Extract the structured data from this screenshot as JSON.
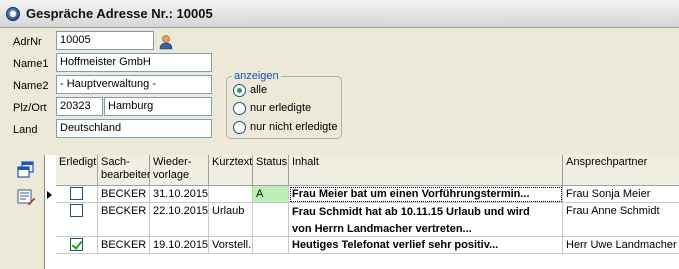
{
  "window": {
    "title": "Gespräche Adresse Nr.: 10005"
  },
  "form": {
    "adrnr_label": "AdrNr",
    "adrnr_value": "10005",
    "name1_label": "Name1",
    "name1_value": "Hoffmeister GmbH",
    "name2_label": "Name2",
    "name2_value": "- Hauptverwaltung -",
    "plzort_label": "Plz/Ort",
    "plz_value": "20323",
    "ort_value": "Hamburg",
    "land_label": "Land",
    "land_value": "Deutschland"
  },
  "filter": {
    "title": "anzeigen",
    "options": [
      "alle",
      "nur erledigte",
      "nur nicht erledigte"
    ],
    "selected": "alle"
  },
  "grid": {
    "columns": {
      "erledigt": "Erledigt",
      "sachbearbeiter_1": "Sach-",
      "sachbearbeiter_2": "bearbeiter",
      "wiedervorlage_1": "Wieder-",
      "wiedervorlage_2": "vorlage",
      "kurztext": "Kurztext",
      "status": "Status",
      "inhalt": "Inhalt",
      "ansprechpartner": "Ansprechpartner"
    },
    "rows": [
      {
        "erledigt": false,
        "sachbearbeiter": "BECKER",
        "wiedervorlage": "31.10.2015",
        "kurztext": "",
        "status": "A",
        "inhalt": "Frau Meier bat um einen Vorführungstermin...",
        "ansprechpartner": "Frau Sonja Meier"
      },
      {
        "erledigt": false,
        "sachbearbeiter": "BECKER",
        "wiedervorlage": "22.10.2015",
        "kurztext": "Urlaub",
        "status": "",
        "inhalt": "Frau Schmidt hat ab 10.11.15 Urlaub und wird",
        "inhalt_line2": "von Herrn Landmacher vertreten...",
        "ansprechpartner": "Frau Anne Schmidt"
      },
      {
        "erledigt": true,
        "sachbearbeiter": "BECKER",
        "wiedervorlage": "19.10.2015",
        "kurztext": "Vorstell.",
        "status": "",
        "inhalt": "Heutiges Telefonat verlief sehr positiv...",
        "ansprechpartner": "Herr Uwe Landmacher"
      }
    ]
  },
  "colors": {
    "accent": "#1c4fb5",
    "status_a_bg": "#bdf0b7",
    "window_bg": "#ece9d8"
  }
}
